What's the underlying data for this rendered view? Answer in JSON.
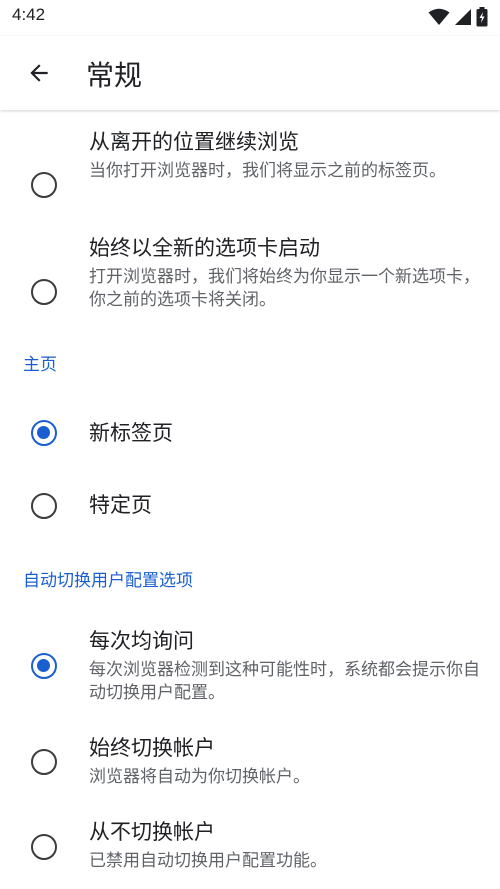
{
  "status_bar": {
    "time": "4:42",
    "icons": [
      "wifi-icon",
      "cellular-signal-icon",
      "battery-charging-icon"
    ]
  },
  "app_bar": {
    "back_icon": "arrow-back-icon",
    "title": "常规"
  },
  "startup_options": [
    {
      "title": "从离开的位置继续浏览",
      "description": "当你打开浏览器时，我们将显示之前的标签页。",
      "checked": false
    },
    {
      "title": "始终以全新的选项卡启动",
      "description": "打开浏览器时，我们将始终为你显示一个新选项卡，你之前的选项卡将关闭。",
      "checked": false
    }
  ],
  "homepage_section": {
    "header": "主页",
    "options": [
      {
        "title": "新标签页",
        "checked": true
      },
      {
        "title": "特定页",
        "checked": false
      }
    ]
  },
  "profile_switch_section": {
    "header": "自动切换用户配置选项",
    "options": [
      {
        "title": "每次均询问",
        "description": "每次浏览器检测到这种可能性时，系统都会提示你自动切换用户配置。",
        "checked": true
      },
      {
        "title": "始终切换帐户",
        "description": "浏览器将自动为你切换帐户。",
        "checked": false
      },
      {
        "title": "从不切换帐户",
        "description": "已禁用自动切换用户配置功能。",
        "checked": false
      }
    ]
  },
  "colors": {
    "accent": "#1a5fd0",
    "text_primary": "#202124",
    "text_secondary": "#5f6368"
  }
}
